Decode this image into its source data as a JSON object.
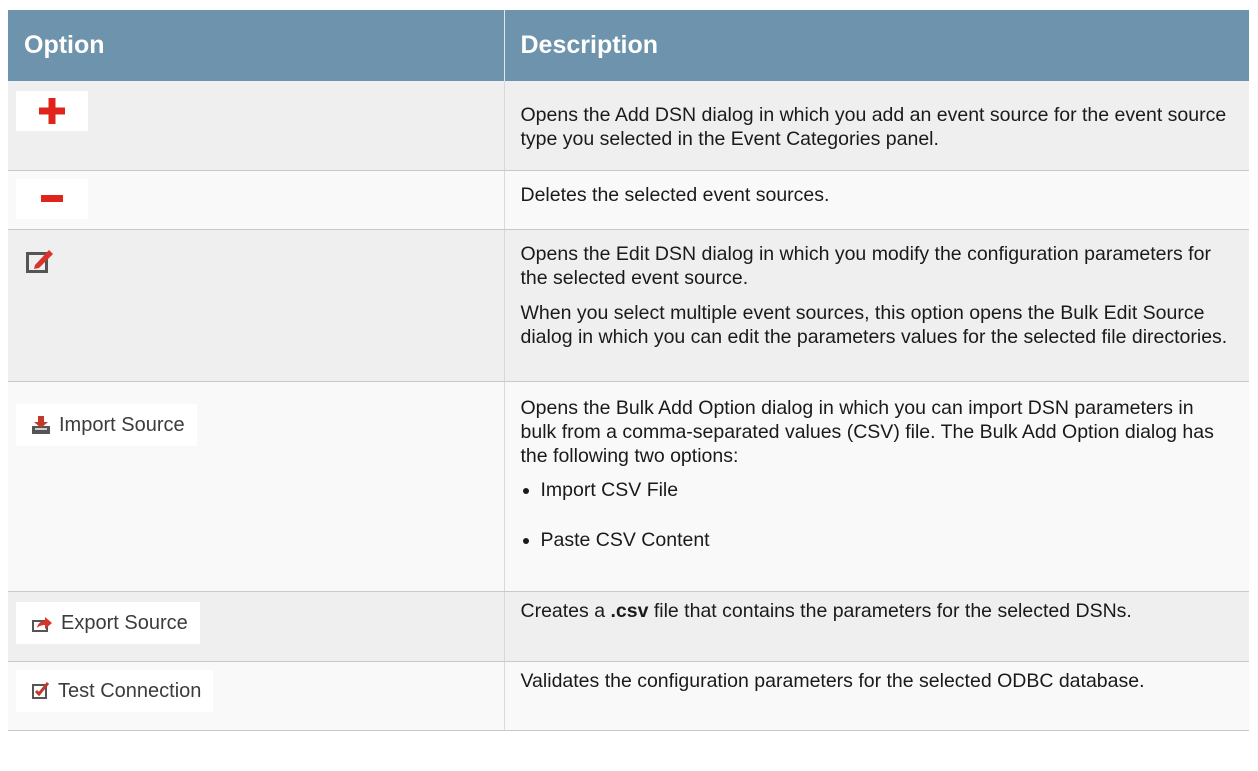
{
  "table": {
    "headers": {
      "option": "Option",
      "description": "Description"
    },
    "rows": [
      {
        "icon": "add-icon",
        "description": [
          "Opens the Add DSN dialog in which you add an event source for the event source type you selected in the Event Categories panel."
        ]
      },
      {
        "icon": "remove-icon",
        "description": [
          "Deletes the selected event sources."
        ]
      },
      {
        "icon": "edit-icon",
        "description": [
          "Opens the Edit DSN dialog in which you modify the configuration parameters for the selected event source.",
          "When you select multiple event sources, this option opens the Bulk Edit Source dialog in which you can edit the parameters values for the selected file directories."
        ]
      },
      {
        "icon": "import-icon",
        "button_label": "Import Source",
        "description": [
          "Opens the Bulk Add Option dialog in which you can import DSN parameters in bulk from a comma-separated values (CSV) file.  The Bulk Add Option dialog has the following two options:"
        ],
        "bullets": [
          "Import CSV File",
          "Paste CSV Content"
        ]
      },
      {
        "icon": "export-icon",
        "button_label": "Export Source",
        "description_prefix": "Creates a ",
        "description_bold": ".csv",
        "description_suffix": " file that contains the parameters for the selected DSNs."
      },
      {
        "icon": "test-connection-icon",
        "button_label": "Test Connection",
        "description": [
          "Validates the configuration parameters for the selected ODBC database."
        ]
      }
    ]
  },
  "colors": {
    "header_bg": "#6e93ad",
    "add_icon": "#e0241c",
    "remove_icon": "#e0241c",
    "import_icon": "#c0392b",
    "export_icon": "#d9342b",
    "test_icon": "#c0392b"
  }
}
